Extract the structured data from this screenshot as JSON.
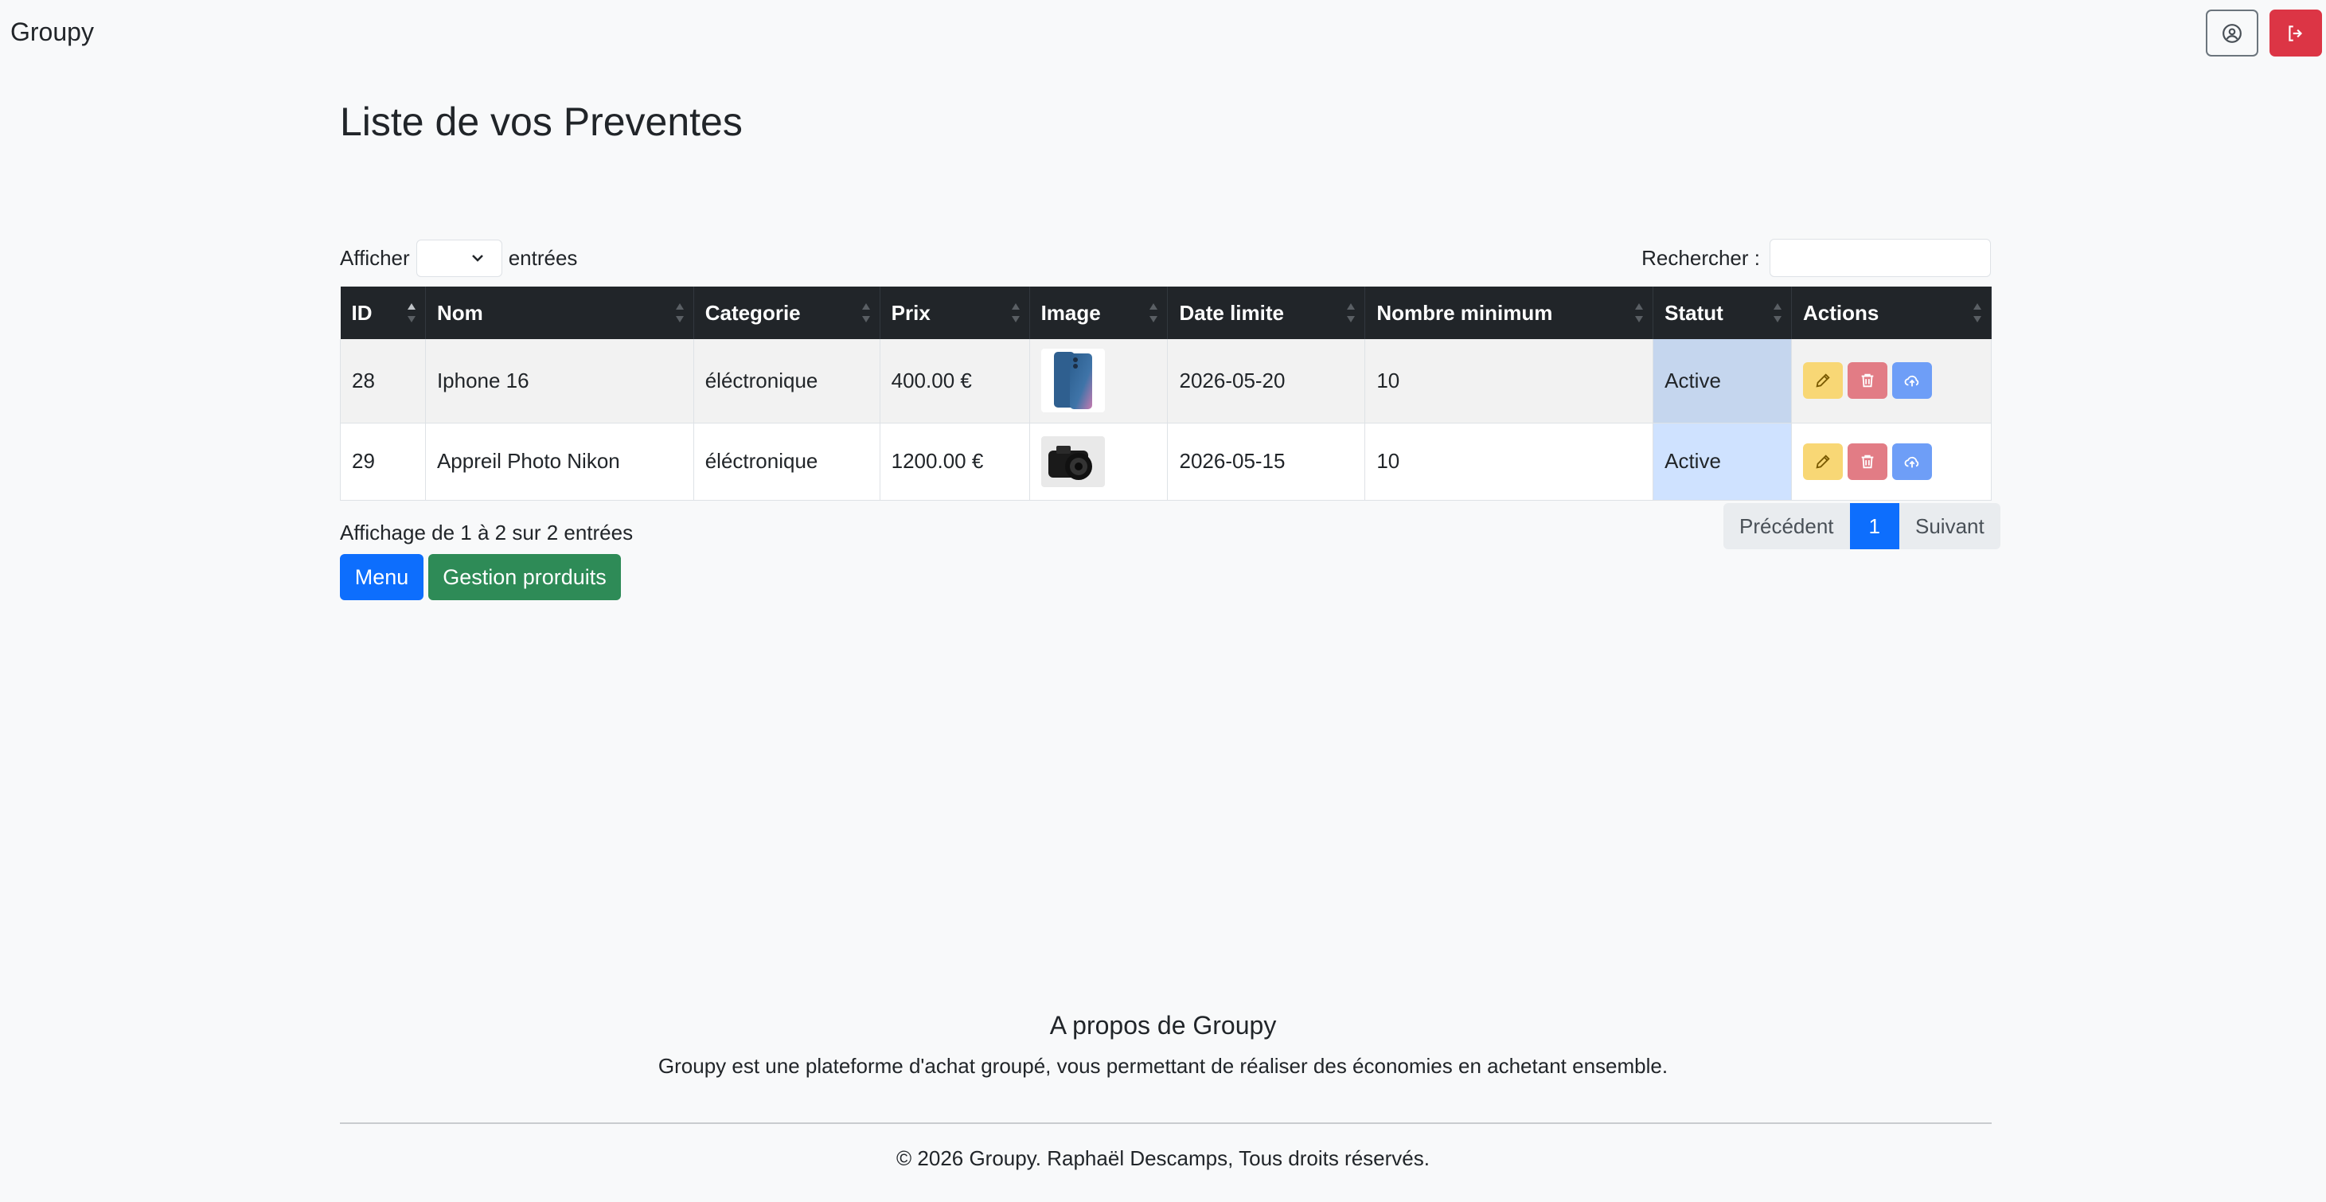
{
  "navbar": {
    "brand": "Groupy",
    "profile_icon": "user-circle-icon",
    "logout_icon": "logout-icon"
  },
  "page": {
    "title": "Liste de vos Preventes"
  },
  "table_controls": {
    "show_label": "Afficher",
    "entries_label": "entrées",
    "page_length_value": "",
    "search_label": "Rechercher :",
    "search_value": ""
  },
  "table": {
    "headers": [
      "ID",
      "Nom",
      "Categorie",
      "Prix",
      "Image",
      "Date limite",
      "Nombre minimum",
      "Statut",
      "Actions"
    ],
    "rows": [
      {
        "id": "28",
        "nom": "Iphone 16",
        "categorie": "éléctronique",
        "prix": "400.00 €",
        "image": "iphone-image",
        "date_limite": "2026-05-20",
        "nombre_minimum": "10",
        "statut": "Active"
      },
      {
        "id": "29",
        "nom": "Appreil Photo Nikon",
        "categorie": "éléctronique",
        "prix": "1200.00 €",
        "image": "camera-image",
        "date_limite": "2026-05-15",
        "nombre_minimum": "10",
        "statut": "Active"
      }
    ]
  },
  "table_info": "Affichage de 1 à 2 sur 2 entrées",
  "pagination": {
    "prev": "Précédent",
    "current": "1",
    "next": "Suivant"
  },
  "buttons": {
    "menu": "Menu",
    "gestion": "Gestion prorduits"
  },
  "footer": {
    "about_title": "A propos de Groupy",
    "about_text": "Groupy est une plateforme d'achat groupé, vous permettant de réaliser des économies en achetant ensemble.",
    "copyright": "© 2026 Groupy. Raphaël Descamps, Tous droits réservés."
  },
  "colors": {
    "primary": "#0d6efd",
    "danger": "#dc3545",
    "success": "#2e8b57",
    "warning": "#f8d775",
    "header_dark": "#212529"
  }
}
